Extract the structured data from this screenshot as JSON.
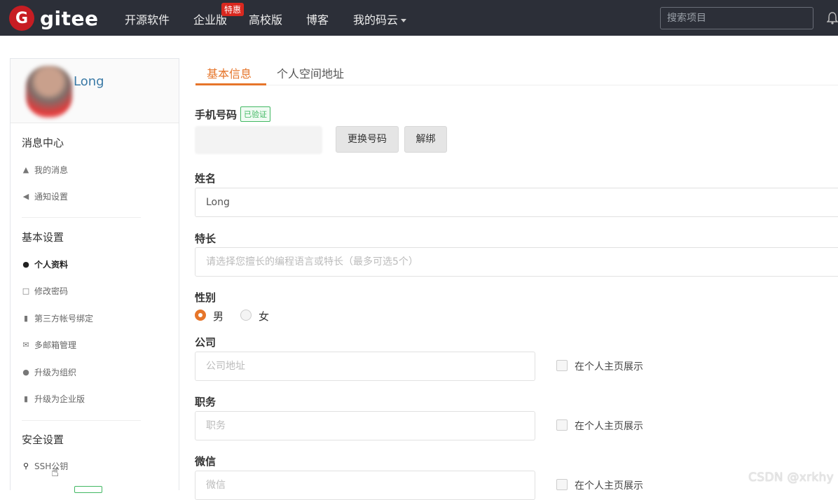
{
  "nav": {
    "logo_mark": "G",
    "logo_text": "gitee",
    "items": [
      "开源软件",
      "企业版",
      "高校版",
      "博客",
      "我的码云"
    ],
    "hot_badge": "特惠",
    "search_placeholder": "搜索项目"
  },
  "sidebar": {
    "username": "Long",
    "sections": [
      {
        "title": "消息中心",
        "items": [
          "我的消息",
          "通知设置"
        ]
      },
      {
        "title": "基本设置",
        "items": [
          "个人资料",
          "修改密码",
          "第三方帐号绑定",
          "多邮箱管理",
          "升级为组织",
          "升级为企业版"
        ]
      },
      {
        "title": "安全设置",
        "items": [
          "SSH公钥"
        ]
      }
    ]
  },
  "tabs": [
    "基本信息",
    "个人空间地址"
  ],
  "form": {
    "phone_label": "手机号码",
    "verified": "已验证",
    "change_btn": "更换号码",
    "unbind_btn": "解绑",
    "name_label": "姓名",
    "name_value": "Long",
    "skill_label": "特长",
    "skill_placeholder": "请选择您擅长的编程语言或特长（最多可选5个）",
    "gender_label": "性别",
    "gender_male": "男",
    "gender_female": "女",
    "company_label": "公司",
    "company_placeholder": "公司地址",
    "position_label": "职务",
    "position_placeholder": "职务",
    "wechat_label": "微信",
    "wechat_placeholder": "微信",
    "show_on_home": "在个人主页展示"
  },
  "watermark": "CSDN @xrkhy",
  "colors": {
    "accent": "#e6752a",
    "nav_bg": "#2c2f38",
    "brand": "#c71d23",
    "verified": "#42b863"
  }
}
